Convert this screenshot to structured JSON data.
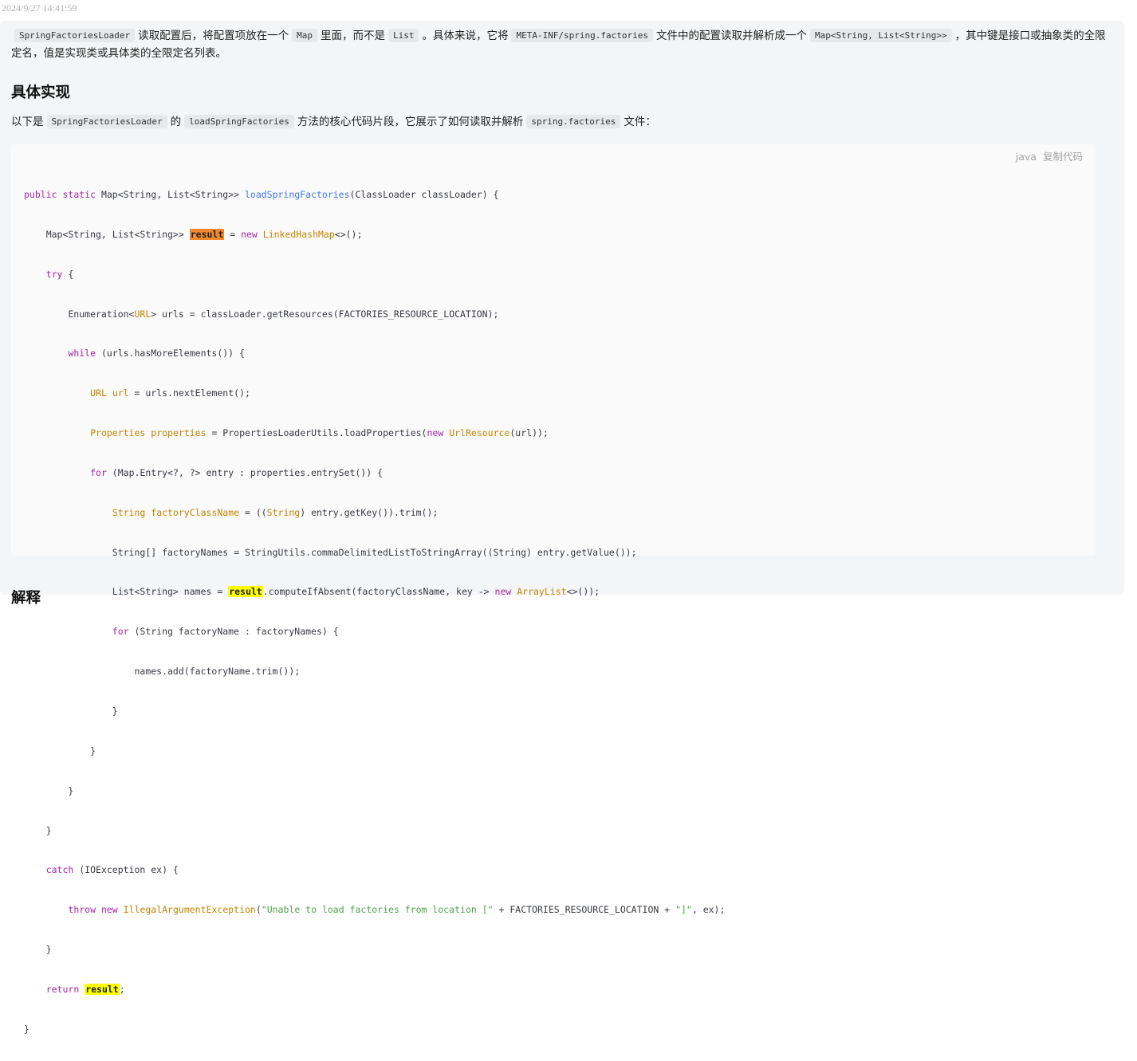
{
  "timestamp": "2024/9/27 14:41:59",
  "para1": {
    "code1": "SpringFactoriesLoader",
    "t1": "读取配置后，将配置项放在一个",
    "code2": "Map",
    "t2": "里面，而不是",
    "code3": "List",
    "t3": "。具体来说，它将",
    "code4": "META-INF/spring.factories",
    "t4": "文件中的配置读取并解析成一个",
    "code5": "Map<String, List<String>>",
    "t5": "，其中键是接口或抽象类的全限定名，值是实现类或具体类的全限定名列表。"
  },
  "heading": "具体实现",
  "para2": {
    "t1": "以下是",
    "code1": "SpringFactoriesLoader",
    "t2": "的",
    "code2": "loadSpringFactories",
    "t3": "方法的核心代码片段，它展示了如何读取并解析",
    "code3": "spring.factories",
    "t4": "文件："
  },
  "code_toolbar": {
    "lang": "java",
    "copy": "复制代码"
  },
  "code_lines": [
    "public static Map<String, List<String>> loadSpringFactories(ClassLoader classLoader) {",
    "    Map<String, List<String>> result = new LinkedHashMap<>();",
    "    try {",
    "        Enumeration<URL> urls = classLoader.getResources(FACTORIES_RESOURCE_LOCATION);",
    "        while (urls.hasMoreElements()) {",
    "            URL url = urls.nextElement();",
    "            Properties properties = PropertiesLoaderUtils.loadProperties(new UrlResource(url));",
    "            for (Map.Entry<?, ?> entry : properties.entrySet()) {",
    "                String factoryClassName = ((String) entry.getKey()).trim();",
    "                String[] factoryNames = StringUtils.commaDelimitedListToStringArray((String) entry.getValue());",
    "                List<String> names = result.computeIfAbsent(factoryClassName, key -> new ArrayList<>());",
    "                for (String factoryName : factoryNames) {",
    "                    names.add(factoryName.trim());",
    "                }",
    "            }",
    "        }",
    "    }",
    "    catch (IOException ex) {",
    "        throw new IllegalArgumentException(\"Unable to load factories from location [\" + FACTORIES_RESOURCE_LOCATION + \"]\", ex);",
    "    }",
    "    return result;",
    "}"
  ],
  "next_heading": "解释"
}
